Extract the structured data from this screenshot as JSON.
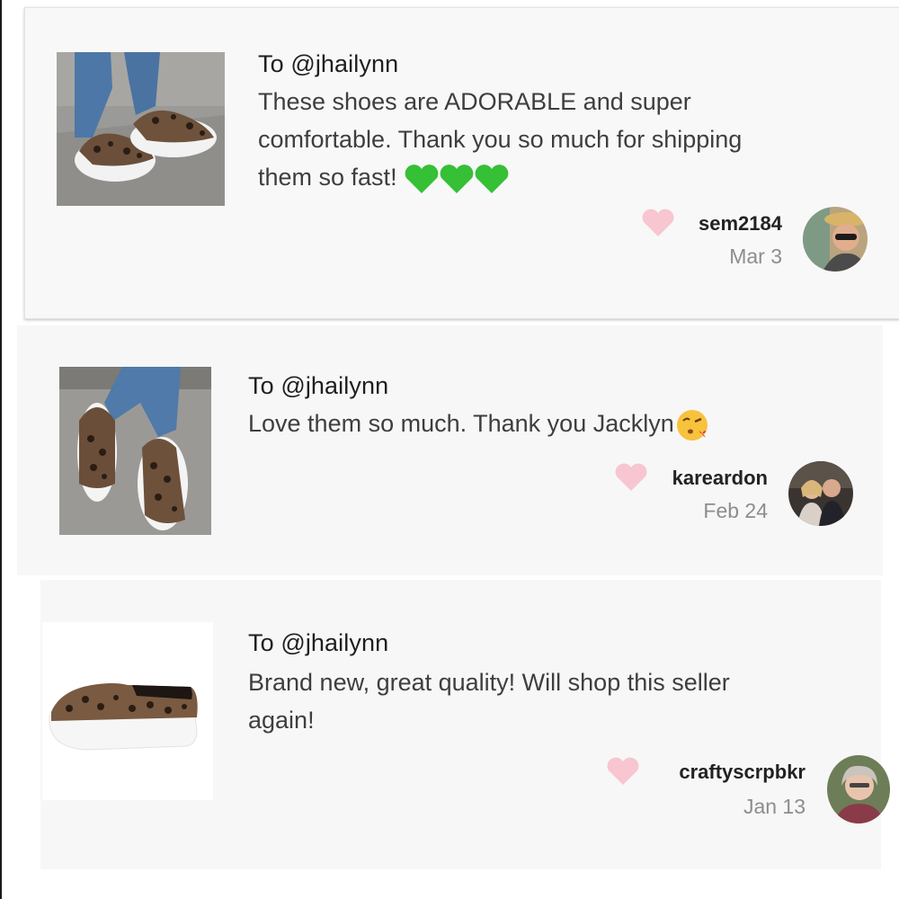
{
  "reviews": [
    {
      "to": "To @jhailynn",
      "message_line1": "These shoes are ADORABLE and super",
      "message_line2": "comfortable. Thank you so much for shipping",
      "message_line3": "them so fast!",
      "message_emoji": "green-heart-icon x3",
      "username": "sem2184",
      "date": "Mar 3"
    },
    {
      "to": "To @jhailynn",
      "message_line1": "Love them so much. Thank you Jacklyn",
      "message_emoji": "face-blowing-kiss-icon",
      "username": "kareardon",
      "date": "Feb 24"
    },
    {
      "to": "To @jhailynn",
      "message_line1": "Brand new, great quality! Will shop this seller",
      "message_line2": "again!",
      "username": "craftyscrpbkr",
      "date": "Jan 13"
    }
  ],
  "colors": {
    "heart_pink": "#f7c6d0",
    "green_heart": "#3cc43c",
    "card_bg": "#f8f8f8"
  }
}
